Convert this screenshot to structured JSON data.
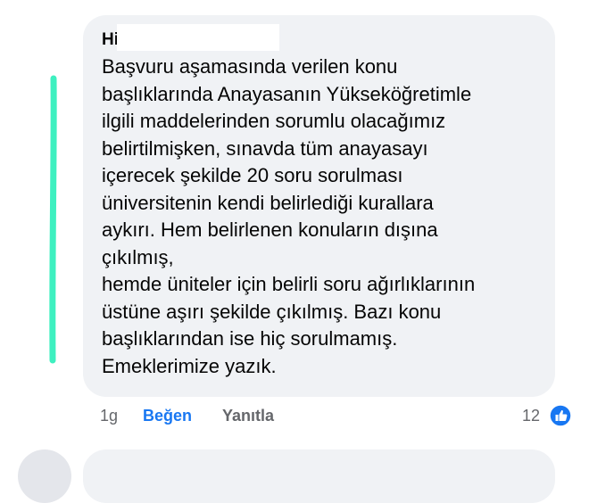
{
  "comment": {
    "author": "Hi",
    "lines": [
      "Başvuru aşamasında verilen konu",
      "başlıklarında Anayasanın Yükseköğretimle",
      "ilgili maddelerinden sorumlu olacağımız",
      "belirtilmişken, sınavda tüm anayasayı",
      "içerecek şekilde 20 soru sorulması",
      "üniversitenin kendi belirlediği kurallara",
      "aykırı. Hem belirlenen konuların dışına",
      "çıkılmış,",
      "hemde üniteler için belirli soru ağırlıklarının",
      "üstüne aşırı şekilde çıkılmış. Bazı konu",
      "başlıklarından ise hiç sorulmamış.",
      "Emeklerimize yazık."
    ]
  },
  "actions": {
    "time": "1g",
    "like_label": "Beğen",
    "reply_label": "Yanıtla"
  },
  "reactions": {
    "count": "12",
    "icon": "thumbs-up-icon"
  },
  "colors": {
    "bubble": "#f0f2f5",
    "link_blue": "#1877f2",
    "meta_gray": "#65676b",
    "annotation_line": "#3ef0c0"
  }
}
